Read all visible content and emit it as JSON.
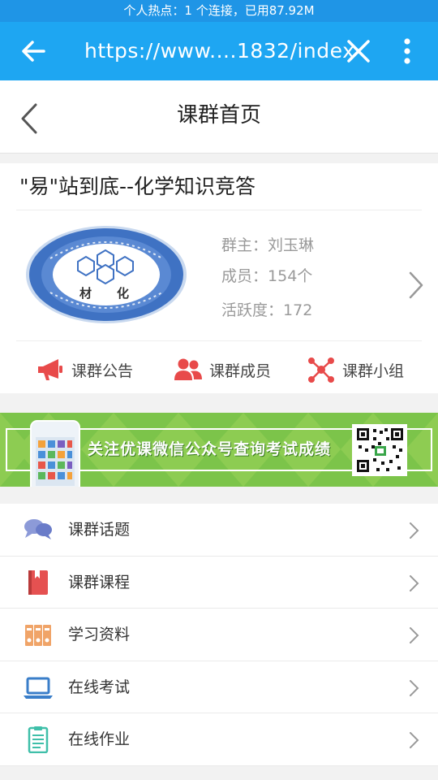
{
  "status_bar": {
    "text": "个人热点：1 个连接，已用87.92M"
  },
  "url_bar": {
    "url": "https://www....1832/index"
  },
  "title_bar": {
    "title": "课群首页"
  },
  "group": {
    "name": "\"易\"站到底--化学知识竞答",
    "owner_label": "群主：",
    "owner": "刘玉琳",
    "members_label": "成员：",
    "members": "154个",
    "activity_label": "活跃度：",
    "activity": "172"
  },
  "actions": [
    {
      "label": "课群公告",
      "icon": "megaphone-icon",
      "color": "#e84a4a"
    },
    {
      "label": "课群成员",
      "icon": "people-icon",
      "color": "#e84a4a"
    },
    {
      "label": "课群小组",
      "icon": "network-icon",
      "color": "#e84a4a"
    }
  ],
  "banner": {
    "text": "关注优课微信公众号查询考试成绩"
  },
  "menu": [
    {
      "label": "课群话题",
      "icon": "chat-bubbles-icon"
    },
    {
      "label": "课群课程",
      "icon": "book-icon"
    },
    {
      "label": "学习资料",
      "icon": "binders-icon"
    },
    {
      "label": "在线考试",
      "icon": "laptop-icon"
    },
    {
      "label": "在线作业",
      "icon": "clipboard-icon"
    }
  ],
  "colors": {
    "status_bar": "#1f95e6",
    "url_bar": "#1ea6f2",
    "banner": "#7cc44a"
  }
}
